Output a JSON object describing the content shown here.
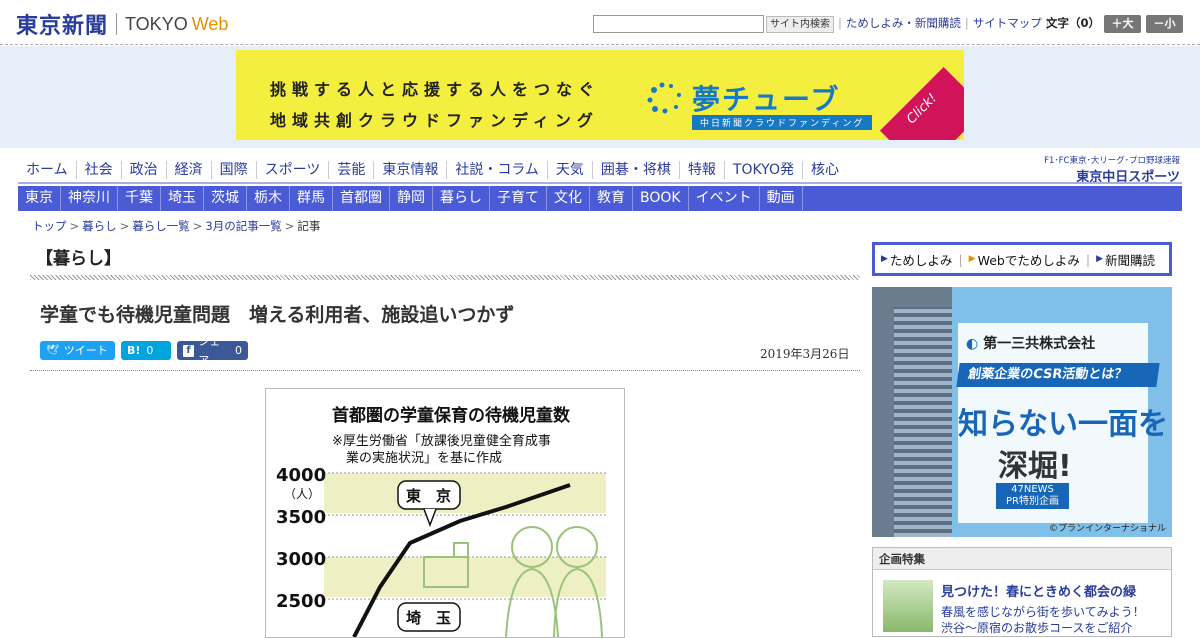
{
  "header": {
    "logo_kanji": "東京新聞",
    "logo_tokyo": "TOKYO",
    "logo_web": "Web",
    "search_button": "サイト内検索",
    "links": [
      "ためしよみ・新聞購読",
      "サイトマップ"
    ],
    "font_label": "文字（0）",
    "font_larger": "＋大",
    "font_smaller": "－小"
  },
  "banner": {
    "line1": "挑戦する人と応援する人をつなぐ",
    "line2": "地域共創クラウドファンディング",
    "brand": "夢チューブ",
    "brand_sub": "中日新聞クラウドファンディング",
    "click": "Click!"
  },
  "nav_primary": [
    "ホーム",
    "社会",
    "政治",
    "経済",
    "国際",
    "スポーツ",
    "芸能",
    "東京情報",
    "社説・コラム",
    "天気",
    "囲碁・将棋",
    "特報",
    "TOKYO発",
    "核心"
  ],
  "chunichi": {
    "sub": "F1･FC東京･大リーグ･プロ野球速報",
    "main": "東京中日スポーツ"
  },
  "nav_regional": [
    "東京",
    "神奈川",
    "千葉",
    "埼玉",
    "茨城",
    "栃木",
    "群馬",
    "首都圏",
    "静岡",
    "暮らし",
    "子育て",
    "文化",
    "教育",
    "BOOK",
    "イベント",
    "動画"
  ],
  "breadcrumb": [
    "トップ",
    "暮らし",
    "暮らし一覧",
    "3月の記事一覧",
    "記事"
  ],
  "article": {
    "section": "【暮らし】",
    "headline": "学童でも待機児童問題　増える利用者、施設追いつかず",
    "date": "2019年3月26日",
    "share_tweet": "ツイート",
    "share_hatena": "B!",
    "share_hatena_count": "0",
    "share_fb": "シェア",
    "share_fb_count": "0"
  },
  "figure": {
    "title": "首都圏の学童保育の待機児童数",
    "note_line1": "※厚生労働省「放課後児童健全育成事",
    "note_line2": "業の実施状況」を基に作成",
    "unit": "（人）",
    "y_ticks": [
      "4000",
      "3500",
      "3000",
      "2500"
    ],
    "label_tokyo": "東　京",
    "label_saitama": "埼　玉"
  },
  "sidebar": {
    "links": [
      "ためしよみ",
      "Webでためしよみ",
      "新聞購読"
    ],
    "ad": {
      "company": "第一三共株式会社",
      "ribbon": "創薬企業のCSR活動とは？",
      "big1": "知らない一面を",
      "big2": "深堀!",
      "news1": "47NEWS",
      "news2": "PR特別企画",
      "credit": "©プランインターナショナル"
    },
    "special": {
      "heading": "企画特集",
      "title": "見つけた！春にときめく都会の緑",
      "desc1": "春風を感じながら街を歩いてみよう！",
      "desc2": "渋谷～原宿のお散歩コースをご紹介"
    }
  },
  "colors": {
    "brand_blue": "#2a3c9c",
    "nav_blue": "#4b5bd6",
    "accent_orange": "#e69100",
    "twitter": "#1da1f2",
    "hatena": "#00a4de",
    "facebook": "#3b5998"
  }
}
